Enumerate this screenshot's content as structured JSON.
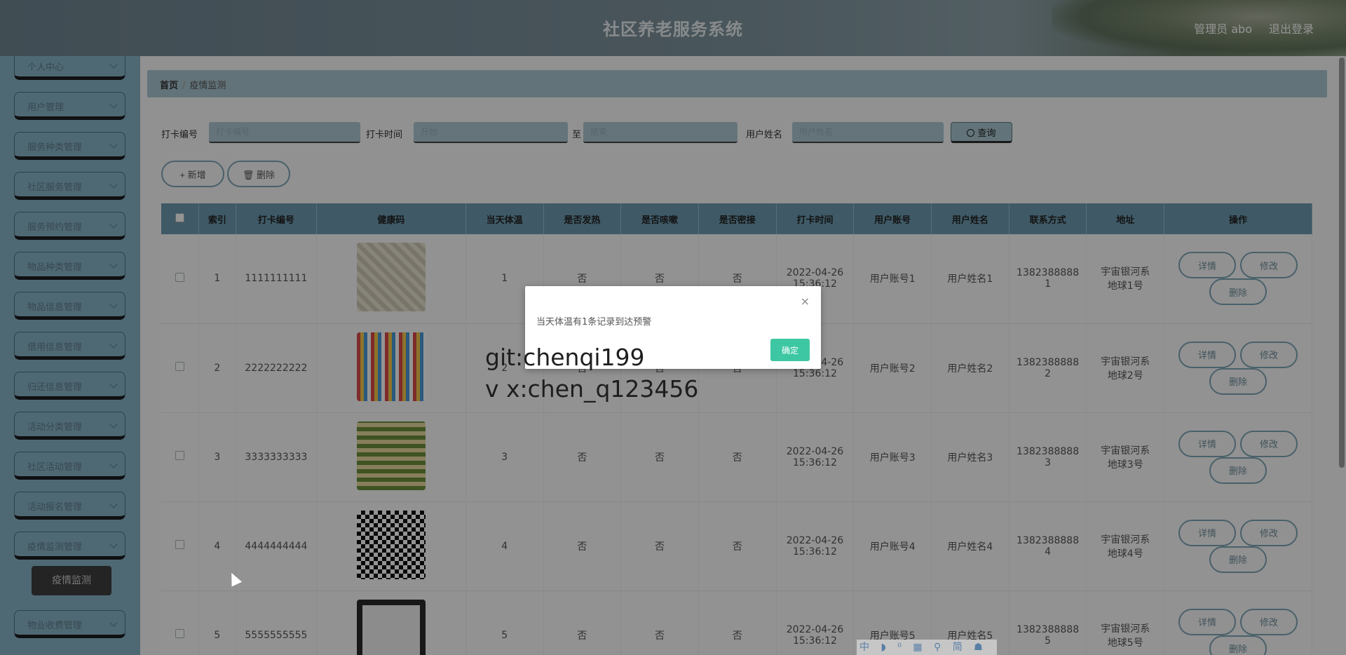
{
  "header": {
    "title": "社区养老服务系统",
    "user": "管理员 abo",
    "logout": "退出登录"
  },
  "sidebar": {
    "items": [
      {
        "label": "个人中心"
      },
      {
        "label": "用户管理"
      },
      {
        "label": "服务种类管理"
      },
      {
        "label": "社区服务管理"
      },
      {
        "label": "服务预约管理"
      },
      {
        "label": "物品种类管理"
      },
      {
        "label": "物品信息管理"
      },
      {
        "label": "借用信息管理"
      },
      {
        "label": "归还信息管理"
      },
      {
        "label": "活动分类管理"
      },
      {
        "label": "社区活动管理"
      },
      {
        "label": "活动报名管理"
      },
      {
        "label": "疫情监测管理"
      },
      {
        "label": "物业收费管理"
      }
    ],
    "active_sub": "疫情监测"
  },
  "breadcrumb": {
    "home": "首页",
    "sep": "/",
    "current": "疫情监测"
  },
  "search": {
    "label_code": "打卡编号",
    "placeholder_code": "打卡编号",
    "label_time": "打卡时间",
    "placeholder_time_start": "开始",
    "sep": "至",
    "placeholder_time_end": "结束",
    "label_name": "用户姓名",
    "placeholder_name": "用户姓名",
    "button": "查询"
  },
  "actions": {
    "add": "+ 新增",
    "delete": "删除"
  },
  "table": {
    "headers": [
      "索引",
      "打卡编号",
      "健康码",
      "当天体温",
      "是否发热",
      "是否咳嗽",
      "是否密接",
      "打卡时间",
      "用户账号",
      "用户姓名",
      "联系方式",
      "地址",
      "操作"
    ],
    "rows": [
      {
        "index": "1",
        "code": "1111111111",
        "temp": "1",
        "fever": "否",
        "cough": "否",
        "contact": "否",
        "time_date": "2022-04-26",
        "time_clock": "15:36:12",
        "account": "用户账号1",
        "name": "用户姓名1",
        "phone_a": "1382388888",
        "phone_b": "1",
        "addr_a": "宇宙银河系",
        "addr_b": "地球1号"
      },
      {
        "index": "2",
        "code": "2222222222",
        "temp": "2",
        "fever": "否",
        "cough": "否",
        "contact": "否",
        "time_date": "2022-04-26",
        "time_clock": "15:36:12",
        "account": "用户账号2",
        "name": "用户姓名2",
        "phone_a": "1382388888",
        "phone_b": "2",
        "addr_a": "宇宙银河系",
        "addr_b": "地球2号"
      },
      {
        "index": "3",
        "code": "3333333333",
        "temp": "3",
        "fever": "否",
        "cough": "否",
        "contact": "否",
        "time_date": "2022-04-26",
        "time_clock": "15:36:12",
        "account": "用户账号3",
        "name": "用户姓名3",
        "phone_a": "1382388888",
        "phone_b": "3",
        "addr_a": "宇宙银河系",
        "addr_b": "地球3号"
      },
      {
        "index": "4",
        "code": "4444444444",
        "temp": "4",
        "fever": "否",
        "cough": "否",
        "contact": "否",
        "time_date": "2022-04-26",
        "time_clock": "15:36:12",
        "account": "用户账号4",
        "name": "用户姓名4",
        "phone_a": "1382388888",
        "phone_b": "4",
        "addr_a": "宇宙银河系",
        "addr_b": "地球4号"
      },
      {
        "index": "5",
        "code": "5555555555",
        "temp": "5",
        "fever": "否",
        "cough": "否",
        "contact": "否",
        "time_date": "2022-04-26",
        "time_clock": "15:36:12",
        "account": "用户账号5",
        "name": "用户姓名5",
        "phone_a": "1382388888",
        "phone_b": "5",
        "addr_a": "宇宙银河系",
        "addr_b": "地球5号"
      }
    ],
    "op_labels": {
      "detail": "详情",
      "edit": "修改",
      "delete": "删除"
    }
  },
  "dialog": {
    "message": "当天体温有1条记录到达预警",
    "ok": "确定",
    "close": "×"
  },
  "watermark": {
    "line1": "git:chenqi199",
    "line2": "v x:chen_q123456"
  },
  "ime_bar": "中 ◗ ⁰ ▦ ⚲ 简 ☗ ⚙",
  "colors": {
    "accent": "#3ec7a3",
    "header": "#7e949e",
    "sidebar": "#89b6c9",
    "table_head": "#6d9bb0"
  }
}
